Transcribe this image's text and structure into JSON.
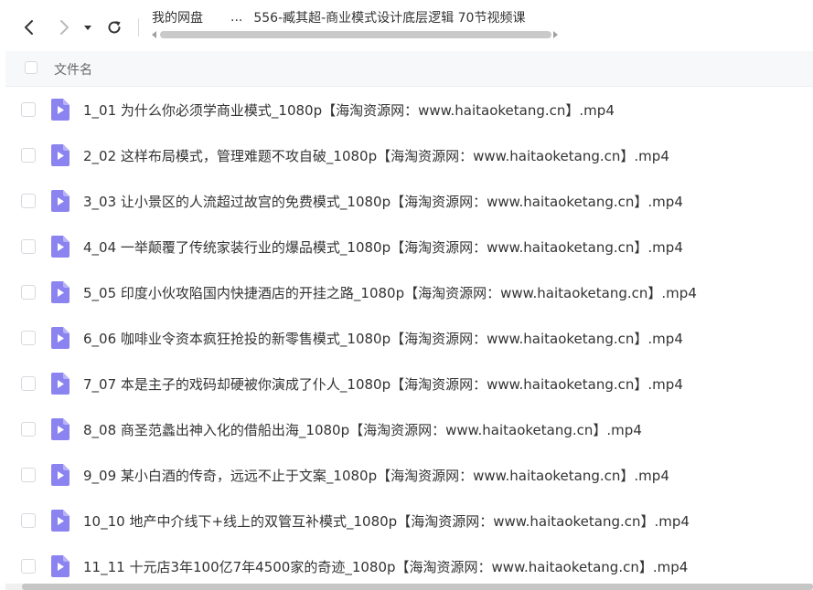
{
  "toolbar": {
    "breadcrumb": {
      "root": "我的网盘",
      "ellipsis": "...",
      "current": "556-臧其超-商业模式设计底层逻辑 70节视频课"
    }
  },
  "header": {
    "column_name": "文件名"
  },
  "files": [
    "1_01 为什么你必须学商业模式_1080p【海淘资源网：www.haitaoketang.cn】.mp4",
    "2_02 这样布局模式，管理难题不攻自破_1080p【海淘资源网：www.haitaoketang.cn】.mp4",
    "3_03 让小景区的人流超过故宫的免费模式_1080p【海淘资源网：www.haitaoketang.cn】.mp4",
    "4_04 一举颠覆了传统家装行业的爆品模式_1080p【海淘资源网：www.haitaoketang.cn】.mp4",
    "5_05 印度小伙攻陷国内快捷酒店的开挂之路_1080p【海淘资源网：www.haitaoketang.cn】.mp4",
    "6_06 咖啡业令资本疯狂抢投的新零售模式_1080p【海淘资源网：www.haitaoketang.cn】.mp4",
    "7_07 本是主子的戏码却硬被你演成了仆人_1080p【海淘资源网：www.haitaoketang.cn】.mp4",
    "8_08 商圣范蠡出神入化的借船出海_1080p【海淘资源网：www.haitaoketang.cn】.mp4",
    "9_09 某小白酒的传奇，远远不止于文案_1080p【海淘资源网：www.haitaoketang.cn】.mp4",
    "10_10 地产中介线下+线上的双管互补模式_1080p【海淘资源网：www.haitaoketang.cn】.mp4",
    "11_11 十元店3年100亿7年4500家的奇迹_1080p【海淘资源网：www.haitaoketang.cn】.mp4"
  ],
  "icons": {
    "back": "chevron-left-icon",
    "forward": "chevron-right-icon",
    "history": "caret-down-icon",
    "refresh": "refresh-icon",
    "file": "video-file-icon"
  },
  "colors": {
    "file_icon": "#8a83f0",
    "header_bg": "#f7f8fa"
  }
}
